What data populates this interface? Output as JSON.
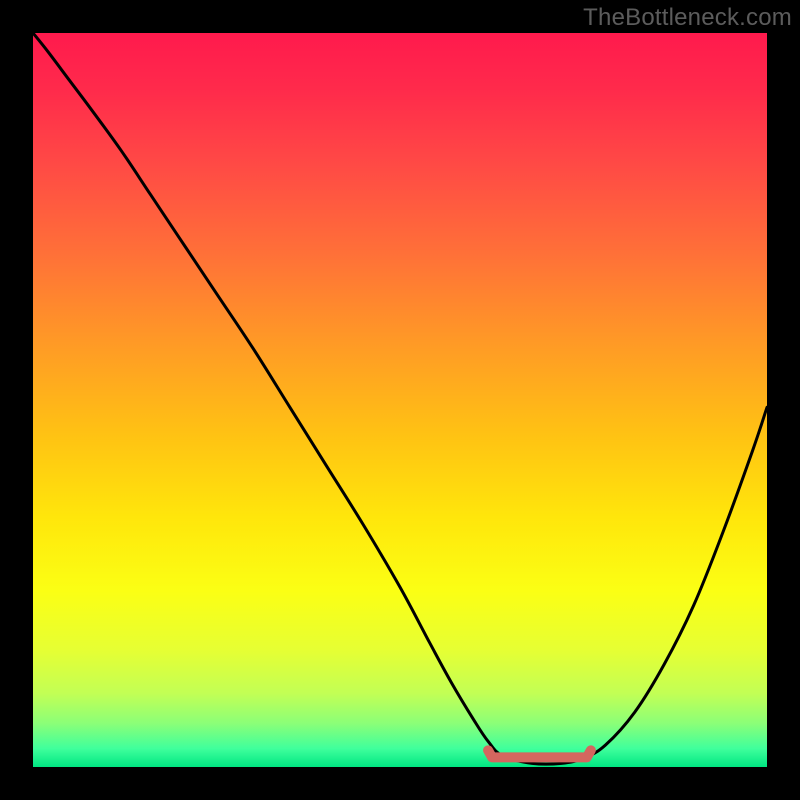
{
  "watermark": "TheBottleneck.com",
  "colors": {
    "frame": "#000000",
    "curve": "#000000",
    "marker_fill": "#d4665f",
    "marker_stroke": "#d4665f",
    "gradient_stops": [
      {
        "offset": 0.0,
        "color": "#ff1a4d"
      },
      {
        "offset": 0.08,
        "color": "#ff2b4b"
      },
      {
        "offset": 0.18,
        "color": "#ff4a45"
      },
      {
        "offset": 0.3,
        "color": "#ff7038"
      },
      {
        "offset": 0.42,
        "color": "#ff9926"
      },
      {
        "offset": 0.55,
        "color": "#ffc313"
      },
      {
        "offset": 0.66,
        "color": "#ffe60b"
      },
      {
        "offset": 0.76,
        "color": "#fbff14"
      },
      {
        "offset": 0.84,
        "color": "#e6ff33"
      },
      {
        "offset": 0.9,
        "color": "#c2ff55"
      },
      {
        "offset": 0.94,
        "color": "#8cff77"
      },
      {
        "offset": 0.975,
        "color": "#3fff9c"
      },
      {
        "offset": 1.0,
        "color": "#00e682"
      }
    ]
  },
  "chart_data": {
    "type": "line",
    "title": "",
    "xlabel": "",
    "ylabel": "",
    "xlim": [
      0,
      100
    ],
    "ylim": [
      0,
      100
    ],
    "x": [
      0,
      2,
      5,
      8,
      12,
      16,
      20,
      25,
      30,
      35,
      40,
      45,
      50,
      54,
      57,
      60,
      62,
      64,
      68,
      72,
      75,
      78,
      82,
      86,
      90,
      94,
      98,
      100
    ],
    "series": [
      {
        "name": "bottleneck-curve",
        "values": [
          100,
          97.5,
          93.5,
          89.5,
          84,
          78,
          72,
          64.5,
          57,
          49,
          41,
          33,
          24.5,
          17,
          11.5,
          6.5,
          3.5,
          1.5,
          0.5,
          0.5,
          1.2,
          3,
          7.5,
          14,
          22,
          32,
          43,
          49
        ]
      }
    ],
    "flat_region": {
      "x_start": 62,
      "x_end": 76,
      "y": 0.5
    },
    "grid": false,
    "legend": false
  }
}
